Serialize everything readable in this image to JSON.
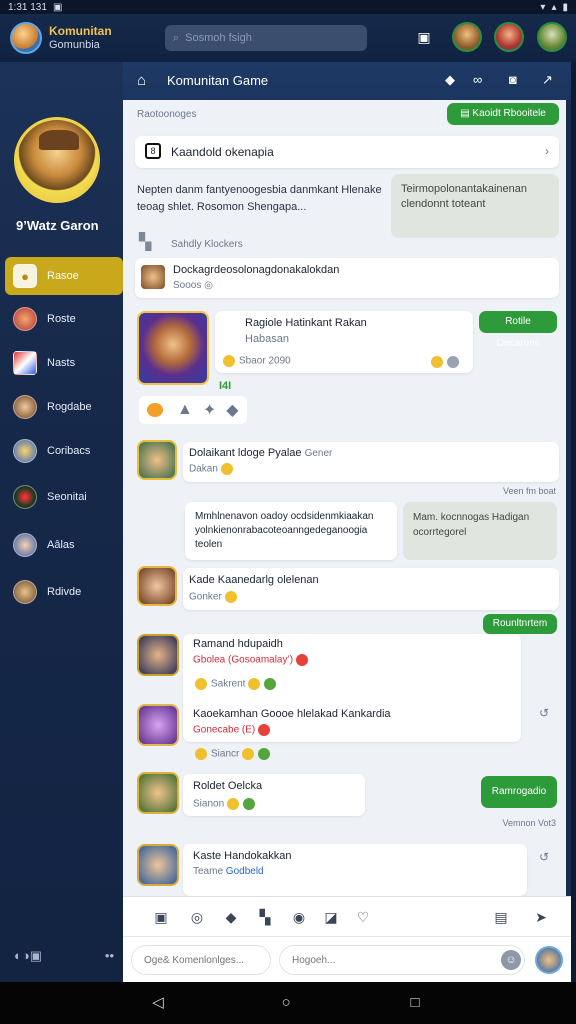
{
  "status": {
    "time": "1:31 131",
    "left_icon": "sim-icon",
    "signal": "▾",
    "wifi": "▴",
    "battery": "▮"
  },
  "app": {
    "title": "Komunitan",
    "subtitle": "Gomunbia",
    "search_placeholder": "Sosmoh fsigh"
  },
  "sidebar": {
    "hero_name": "9’Watz Garon",
    "items": [
      {
        "label": "Rasoe"
      },
      {
        "label": "Roste"
      },
      {
        "label": "Nasts"
      },
      {
        "label": "Rogdabe"
      },
      {
        "label": "Coribacs"
      },
      {
        "label": "Seonitai"
      },
      {
        "label": "Aâlas"
      },
      {
        "label": "Rdivde"
      }
    ]
  },
  "main": {
    "header_title": "Komunitan Game",
    "section1": "Raotoonoges",
    "pill_top": "Kaoidt Rbooitele",
    "link_card": "Kaandold okenapia",
    "text_block": "Nepten danm fantyenoogesbia danmkant Hlenake\nteoag shlet.        Rosomon        Shengapa...",
    "grey_note": "Teirmopolonantakainenan\nclendonnt toteant",
    "section2": "Sahdly Klockers",
    "notice_title": "Dockagrdeosolonagdonakalokdan",
    "notice_meta": "Sooos",
    "featured": {
      "title": "Ragiole Hatinkant Rakan",
      "subtitle": "Habasan",
      "stats": "Sbaor 2090",
      "badge": "I4I",
      "pill": "Rotile Oecarons"
    },
    "msgs": [
      {
        "title": "Dolaikant ldoge Pyalae",
        "suffix": "Gener",
        "meta": "Dakan"
      },
      {
        "text": "Mmhlnenavon oadoy ocdsidenmkiaakan\nyolnkienonrabacoteoanngedeganoogia\nteolen"
      },
      {
        "grey": "Mam. kocnnogas Hadigan\nocorrtegorel"
      },
      {
        "title": "Kade  Kaanedarlg olelenan",
        "meta": "Gonker"
      },
      {
        "title": "Ramand hdupaidh",
        "red": "Gbolea (Gosoamalay’)",
        "meta": "Sakrent"
      },
      {
        "title": "Kaoekamhan Goooe hlelakad Kankardia",
        "red": "Gonecabe (E)",
        "meta": "Siancr"
      },
      {
        "title": "Roldet Oelcka",
        "meta": "Sianon"
      },
      {
        "title": "Kaste Handokakkan",
        "blue": "Godbeld",
        "meta": "Teame"
      }
    ],
    "pill_mid_right": "Rounltnrtem",
    "pill_lower": "Ramrogadio",
    "time_labels": {
      "t1": "Veen fm  boat",
      "t2": "Vemnon  Vot3"
    },
    "comment_placeholder": "Oge& Komenlonlges...",
    "search2_placeholder": "Hogoeh..."
  },
  "icons": {
    "top": [
      "device-icon"
    ],
    "toolbar_count": 9
  },
  "colors": {
    "accent_green": "#2e9b3b",
    "sidebar_active": "#c9a81c",
    "header_navy": "#1f3a66"
  }
}
